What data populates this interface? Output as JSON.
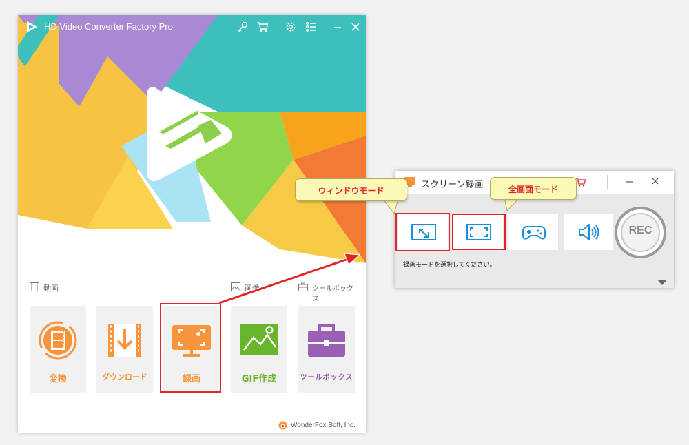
{
  "main_window": {
    "title": "HD Video Converter Factory Pro",
    "titlebar_icons": [
      "key-icon",
      "cart-icon",
      "gear-icon",
      "menu-icon",
      "minimize-icon",
      "close-icon"
    ],
    "sections": {
      "video": "動画",
      "image": "画像",
      "tools": "ツールボックス"
    },
    "tiles": [
      {
        "label": "変換",
        "icon": "film-reel-icon",
        "color": "#f7943c"
      },
      {
        "label": "ダウンロード",
        "icon": "download-film-icon",
        "color": "#f7943c"
      },
      {
        "label": "録画",
        "icon": "screen-record-icon",
        "color": "#f7943c"
      },
      {
        "label": "GIF作成",
        "icon": "landscape-image-icon",
        "color": "#6ab52e"
      },
      {
        "label": "ツールボックス",
        "icon": "toolbox-icon",
        "color": "#9b5fb5"
      }
    ],
    "footer": "WonderFox Soft, Inc."
  },
  "recorder": {
    "title": "スクリーン録画",
    "modes": [
      "window-mode-icon",
      "fullscreen-mode-icon",
      "game-mode-icon",
      "audio-only-icon"
    ],
    "rec_label": "REC",
    "status": "録画モードを選択してください。"
  },
  "annotations": {
    "window_mode": "ウィンドウモード",
    "fullscreen_mode": "全画面モード"
  },
  "colors": {
    "accent_orange": "#f7943c",
    "highlight_red": "#e0262a",
    "mode_icon_blue": "#1a8fd8",
    "callout_bg": "#fbf9b7"
  }
}
